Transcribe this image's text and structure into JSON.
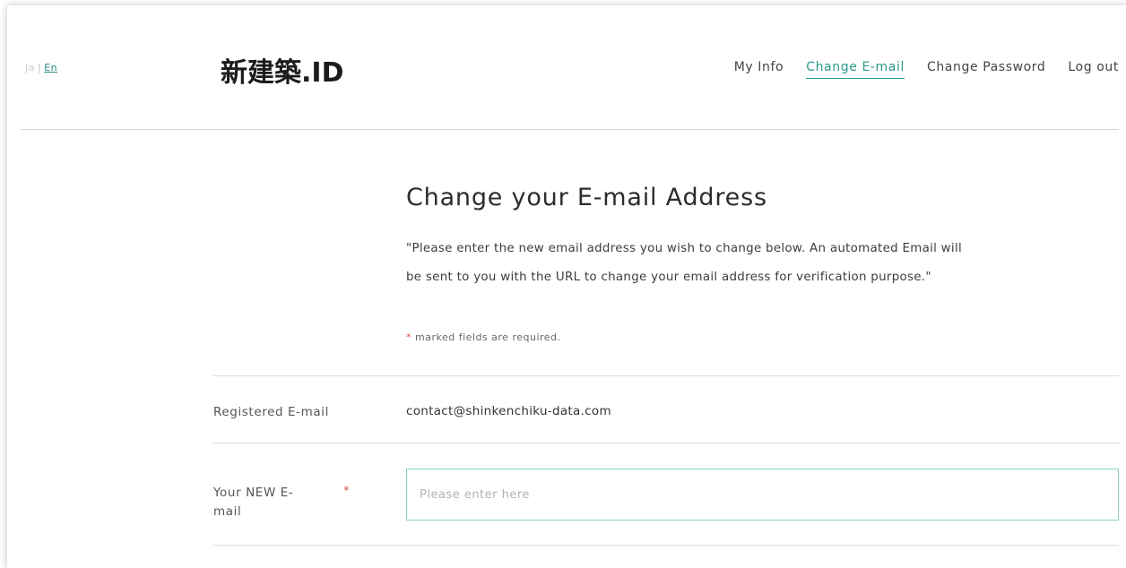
{
  "language": {
    "ja": "Ja",
    "separator": "|",
    "en": "En"
  },
  "logo": {
    "kanji": "新建築",
    "dot": ".",
    "id": "ID"
  },
  "nav": {
    "items": [
      {
        "label": "My Info"
      },
      {
        "label": "Change E-mail",
        "active": true
      },
      {
        "label": "Change Password"
      },
      {
        "label": "Log out"
      }
    ]
  },
  "page": {
    "title": "Change your E-mail Address",
    "description_line1": "\"Please enter the new email address you wish to change below. An automated Email will",
    "description_line2": "be sent to you with the URL to change your email address for verification purpose.\"",
    "required_mark": "*",
    "required_note": " marked fields are required."
  },
  "form": {
    "registered_label": "Registered E-mail",
    "registered_value": "contact@shinkenchiku-data.com",
    "new_email_label_line1": "Your NEW E-",
    "new_email_label_line2": "mail",
    "new_email_required": "*",
    "new_email_value": "",
    "new_email_placeholder": "Please enter here"
  },
  "colors": {
    "accent": "#2a9a8c",
    "input_border": "#8ccfc2",
    "required": "#d9534f"
  }
}
